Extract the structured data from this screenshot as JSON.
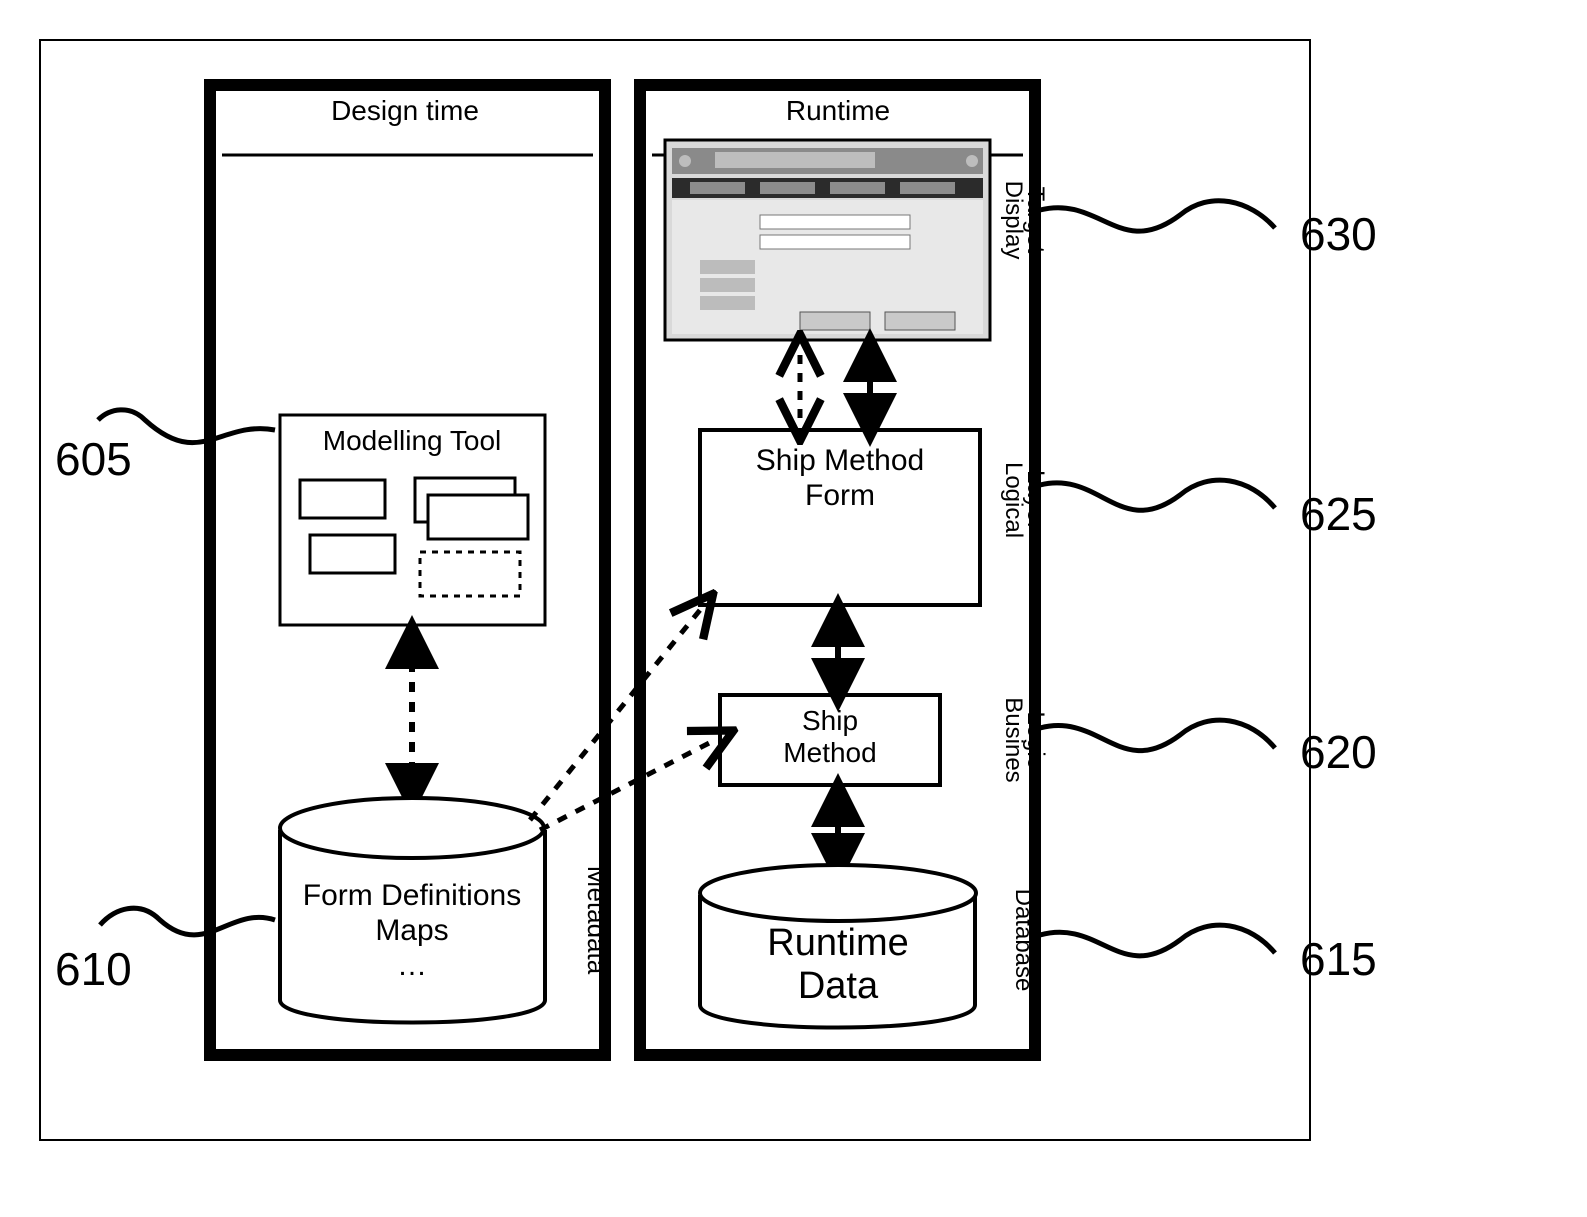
{
  "left_panel": {
    "title": "Design time",
    "modeling_tool": "Modelling Tool",
    "db": {
      "line1": "Form Definitions",
      "line2": "Maps",
      "line3": "…"
    },
    "side_label": "Metadata"
  },
  "right_panel": {
    "title": "Runtime",
    "logical": {
      "line1": "Ship Method",
      "line2": "Form"
    },
    "business": {
      "line1": "Ship",
      "line2": "Method"
    },
    "db": {
      "line1": "Runtime",
      "line2": "Data"
    },
    "labels": {
      "display_target": {
        "line1": "Display",
        "line2": "Target"
      },
      "logical_layer": {
        "line1": "Logical",
        "line2": "Layer"
      },
      "business_logic": {
        "line1": "Busines",
        "line2": "Logic"
      },
      "database": "Database"
    }
  },
  "callouts": {
    "c605": "605",
    "c610": "610",
    "c615": "615",
    "c620": "620",
    "c625": "625",
    "c630": "630"
  }
}
